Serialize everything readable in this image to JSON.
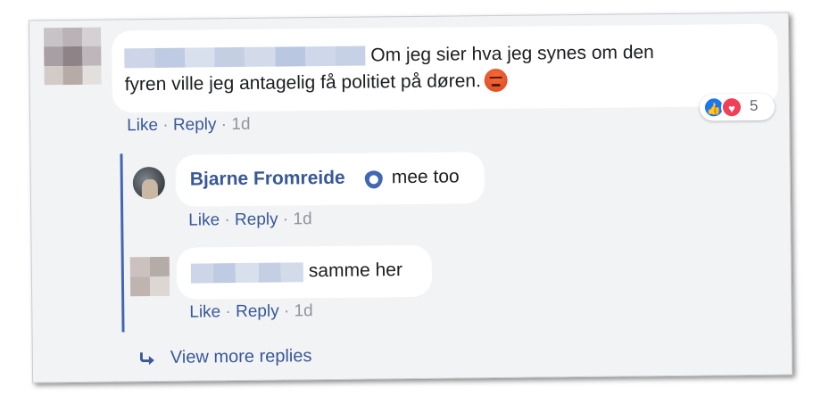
{
  "comment": {
    "text_line1": "Om jeg sier hva jeg synes om den",
    "text_line2": "fyren ville jeg antagelig få politiet på døren.",
    "emoji": "angry-face-icon",
    "actions": {
      "like": "Like",
      "separator": "·",
      "reply": "Reply",
      "time": "1d"
    },
    "reactions": {
      "count": "5",
      "types": [
        "like-icon",
        "love-icon"
      ]
    }
  },
  "replies": [
    {
      "author": "Bjarne Fromreide",
      "badge": "verified-shield-icon",
      "text": "mee too",
      "actions": {
        "like": "Like",
        "separator": "·",
        "reply": "Reply",
        "time": "1d"
      }
    },
    {
      "text": "samme her",
      "actions": {
        "like": "Like",
        "separator": "·",
        "reply": "Reply",
        "time": "1d"
      }
    }
  ],
  "view_more": "View more replies",
  "colors": {
    "link": "#385898",
    "thread_line": "#4267b2",
    "background": "#f2f3f5",
    "bubble": "#ffffff"
  }
}
